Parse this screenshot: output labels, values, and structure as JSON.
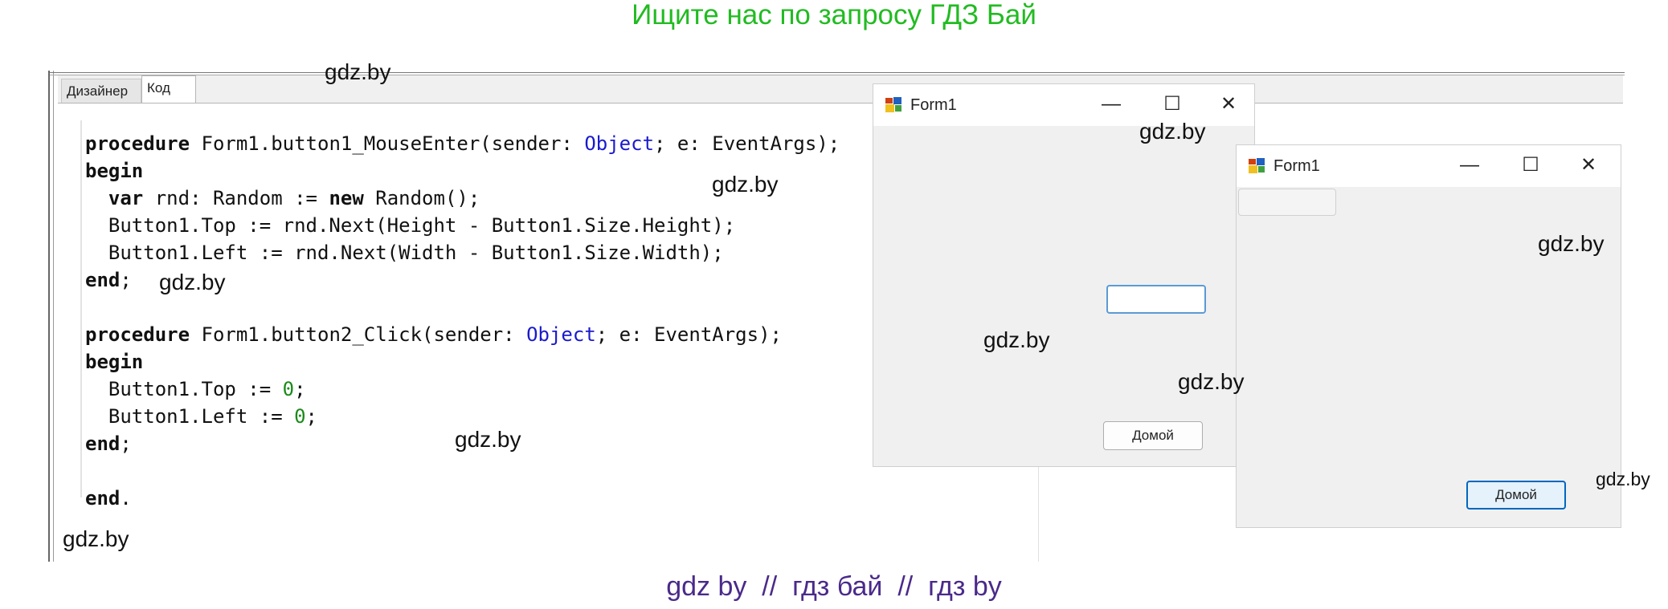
{
  "banner": "Ищите нас по запросу ГДЗ Бай",
  "ide": {
    "tabs": [
      {
        "label": "Дизайнер",
        "active": false
      },
      {
        "label": "Код",
        "active": true
      }
    ],
    "code_lines": [
      "procedure Form1.button1_MouseEnter(sender: Object; e: EventArgs);",
      "begin",
      "  var rnd: Random := new Random();",
      "  Button1.Top := rnd.Next(Height - Button1.Size.Height);",
      "  Button1.Left := rnd.Next(Width - Button1.Size.Width);",
      "end;",
      "",
      "procedure Form1.button2_Click(sender: Object; e: EventArgs);",
      "begin",
      "  Button1.Top := 0;",
      "  Button1.Left := 0;",
      "end;",
      "",
      "end."
    ]
  },
  "form_window_1": {
    "title": "Form1",
    "controls": {
      "minimize": "—",
      "maximize": "☐",
      "close": "✕"
    },
    "button_label": "Домой"
  },
  "form_window_2": {
    "title": "Form1",
    "controls": {
      "minimize": "—",
      "maximize": "☐",
      "close": "✕"
    },
    "button_label": "Домой"
  },
  "watermark": "gdz.by",
  "footer": "gdz by  //  гдз бай  //  гдз by",
  "colors": {
    "banner": "#22bb22",
    "footer": "#4a2a8a",
    "keyword_type": "#1a1acc",
    "number": "#1a8a1a",
    "focus_accent": "#0067c0"
  }
}
